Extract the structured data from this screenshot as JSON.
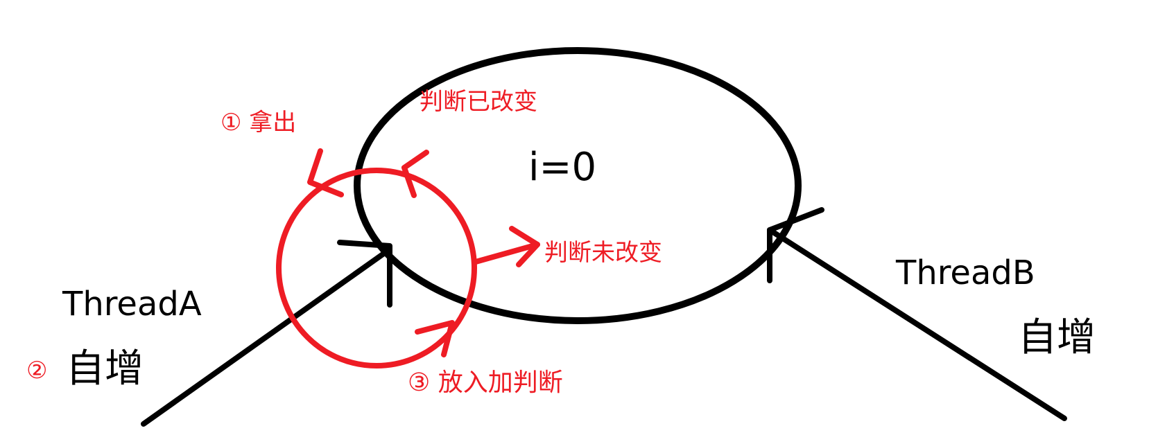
{
  "diagram": {
    "center_value": "i=0",
    "thread_a": {
      "name": "ThreadA",
      "step_marker": "②",
      "action": "自增"
    },
    "thread_b": {
      "name": "ThreadB",
      "action": "自增"
    },
    "cas_steps": {
      "step1": "① 拿出",
      "step3": "③ 放入加判断",
      "changed": "判断已改变",
      "unchanged": "判断未改变"
    },
    "colors": {
      "ink": "#000000",
      "accent": "#ee1c24",
      "background": "#ffffff"
    }
  }
}
